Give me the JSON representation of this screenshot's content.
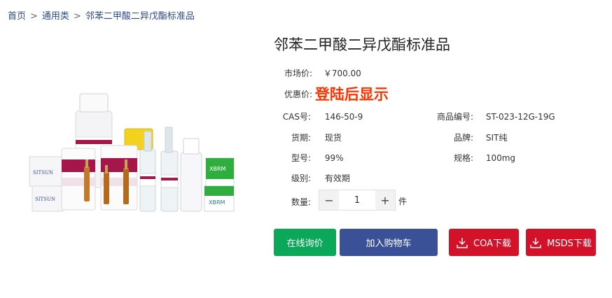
{
  "breadcrumb": {
    "home": "首页",
    "sep1": ">",
    "category": "通用类",
    "sep2": ">",
    "current": "邻苯二甲酸二异戊酯标准品"
  },
  "product": {
    "title": "邻苯二甲酸二异戊酯标准品",
    "market_price_label": "市场价:",
    "market_price": "￥700.00",
    "promo_price_label": "优惠价:",
    "promo_price": "登陆后显示",
    "cas_label": "CAS号:",
    "cas": "146-50-9",
    "product_no_label": "商品编号:",
    "product_no": "ST-023-12G-19G",
    "stock_label": "货期:",
    "stock": "现货",
    "brand_label": "品牌:",
    "brand": "SIT纯",
    "model_label": "型号:",
    "model": "99%",
    "spec_label": "规格:",
    "spec": "100mg",
    "grade_label": "级别:",
    "grade": "有效期",
    "qty_label": "数量:",
    "qty_minus": "−",
    "qty_value": "1",
    "qty_plus": "+",
    "qty_unit": "件"
  },
  "actions": {
    "inquiry": "在线询价",
    "cart": "加入购物车",
    "coa": "COA下载",
    "msds": "MSDS下载"
  },
  "product_image_text": {
    "logo_left": "SITSUN",
    "logo_right": "XBRM"
  },
  "colors": {
    "breadcrumb": "#2b4a8b",
    "promo": "#ff3300",
    "inquiry_btn": "#0aa858",
    "cart_btn": "#3a5197",
    "download_btn": "#d3122a"
  }
}
